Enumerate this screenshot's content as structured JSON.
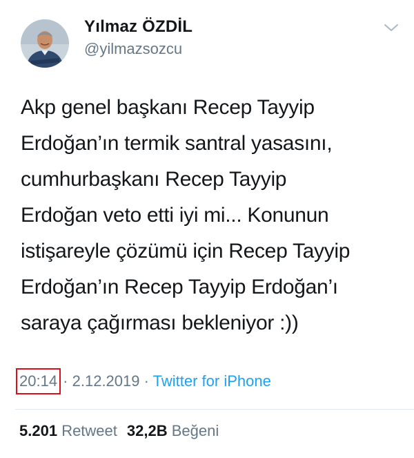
{
  "author": {
    "name": "Yılmaz ÖZDİL",
    "handle": "@yilmazsozcu",
    "avatar_icon": "profile-photo"
  },
  "menu_icon": "chevron-down-icon",
  "tweet": {
    "text": "Akp genel başkanı Recep Tayyip\nErdoğan’ın termik santral yasasını,\ncumhurbaşkanı Recep Tayyip\nErdoğan veto etti iyi mi... Konunun\nistişareyle çözümü için Recep Tayyip\nErdoğan’ın Recep Tayyip Erdoğan’ı\nsaraya çağırması bekleniyor :))",
    "time": "20:14",
    "separator": " · ",
    "date": "2.12.2019",
    "source": "Twitter for iPhone"
  },
  "stats": {
    "retweets_count": "5.201",
    "retweets_label": "Retweet",
    "likes_count": "32,2B",
    "likes_label": "Beğeni"
  },
  "colors": {
    "text": "#14171a",
    "secondary": "#657786",
    "link": "#1da1f2",
    "highlight_box": "#d9101b",
    "divider": "#e1e8ed"
  }
}
